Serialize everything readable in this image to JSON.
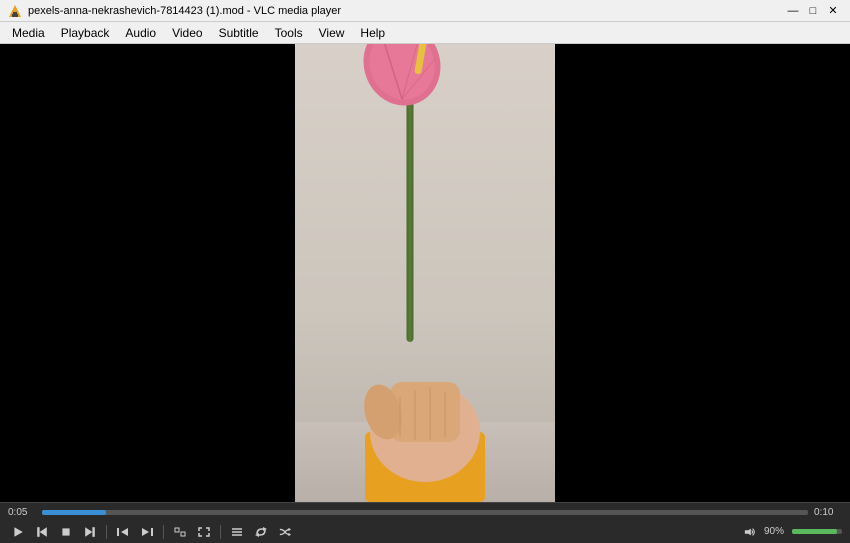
{
  "window": {
    "title": "pexels-anna-nekrashevich-7814423 (1).mod - VLC media player",
    "title_short": "pexels-anna-nekrashevich-7814423 (1).mod - VLC media player"
  },
  "menu": {
    "items": [
      "Media",
      "Playback",
      "Audio",
      "Video",
      "Subtitle",
      "Tools",
      "View",
      "Help"
    ]
  },
  "controls": {
    "time_current": "0:05",
    "time_total": "0:10",
    "volume_percent": "90%",
    "progress_percent": 8.3,
    "volume_value": 90
  },
  "buttons": {
    "play": "▶",
    "prev": "⏮",
    "stop": "⏹",
    "next": "⏭",
    "frame_back": "◀|",
    "frame_fwd": "|▶",
    "fullscreen": "⛶",
    "playlist": "☰",
    "loop": "↺",
    "random": "⇄",
    "volume_icon": "🔊",
    "minimize": "—",
    "maximize": "□",
    "close": "✕"
  }
}
